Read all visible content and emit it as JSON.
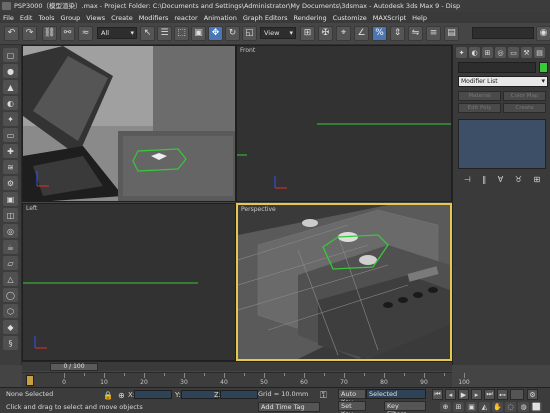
{
  "window": {
    "title": "PSP3000（模型渲染）.max  -  Project Folder: C:\\Documents and Settings\\Administrator\\My Documents\\3dsmax  -  Autodesk 3ds Max 9  -  Disp"
  },
  "menu": {
    "items": [
      "File",
      "Edit",
      "Tools",
      "Group",
      "Views",
      "Create",
      "Modifiers",
      "reactor",
      "Animation",
      "Graph Editors",
      "Rendering",
      "Customize",
      "MAXScript",
      "Help"
    ]
  },
  "toolbar": {
    "selection_filter": "All",
    "reference_coord": "View"
  },
  "viewports": {
    "top_label": "",
    "front_label": "Front",
    "left_label": "Left",
    "perspective_label": "Perspective"
  },
  "command_panel": {
    "modifier_list": "Modifier List",
    "buttons": [
      "Material",
      "Color Map",
      "Edit Poly",
      "Create"
    ]
  },
  "timeline": {
    "frame_display": "0 / 100",
    "ticks": [
      "0",
      "10",
      "20",
      "30",
      "40",
      "50",
      "60",
      "70",
      "80",
      "90",
      "100"
    ]
  },
  "status": {
    "selection": "None Selected",
    "prompt": "Click and drag to select and move objects",
    "x_label": "X:",
    "y_label": "Y:",
    "z_label": "Z:",
    "grid": "Grid = 10.0mm",
    "auto_key": "Auto Key",
    "set_key": "Set Key",
    "key_mode": "Selected",
    "key_filters": "Key Filters...",
    "add_time_tag": "Add Time Tag"
  },
  "colors": {
    "accent_active": "#4a77b4",
    "selection_green": "#38c838",
    "active_viewport": "#e8c84a"
  }
}
